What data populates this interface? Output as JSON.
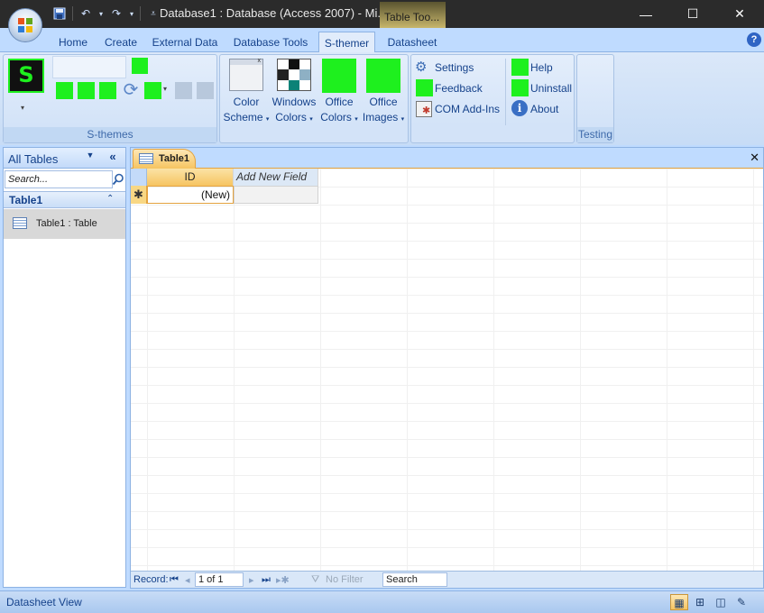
{
  "window": {
    "title": "Database1 : Database (Access 2007) - Mi...",
    "context_tab": "Table Too...",
    "minimize_glyph": "—",
    "maximize_glyph": "☐",
    "close_glyph": "✕"
  },
  "ribbon_tabs": [
    "Home",
    "Create",
    "External Data",
    "Database Tools",
    "S-themer",
    "Datasheet"
  ],
  "active_tab": "S-themer",
  "ribbon": {
    "s_themes": {
      "logo_letter": "S",
      "group_label": "S-themes",
      "dropdown_glyph": "▾"
    },
    "colors_group": {
      "color_scheme": [
        "Color",
        "Scheme"
      ],
      "windows_colors": [
        "Windows",
        "Colors"
      ],
      "office_colors": [
        "Office",
        "Colors"
      ],
      "office_images": [
        "Office",
        "Images"
      ]
    },
    "links_group": {
      "settings": "Settings",
      "feedback": "Feedback",
      "com_addins": "COM Add-Ins",
      "help": "Help",
      "uninstall": "Uninstall",
      "about": "About"
    },
    "testing_label": "Testing"
  },
  "nav_pane": {
    "header": "All Tables",
    "search_placeholder": "Search...",
    "group_label": "Table1",
    "items": [
      {
        "label": "Table1 : Table"
      }
    ]
  },
  "document": {
    "tab_label": "Table1",
    "close_glyph": "✕",
    "columns": [
      "ID",
      "Add New Field"
    ],
    "new_row": {
      "marker": "✱",
      "id_value": "(New)"
    }
  },
  "record_nav": {
    "label": "Record:",
    "current": "1 of 1",
    "filter": "No Filter",
    "search": "Search"
  },
  "status_bar": {
    "text": "Datasheet View"
  },
  "colors": {
    "accent_green": "#1ef01e",
    "ribbon_blue": "#bfdbff",
    "active_tab_orange": "#f6c461",
    "title_bar": "#2b2b2b"
  }
}
